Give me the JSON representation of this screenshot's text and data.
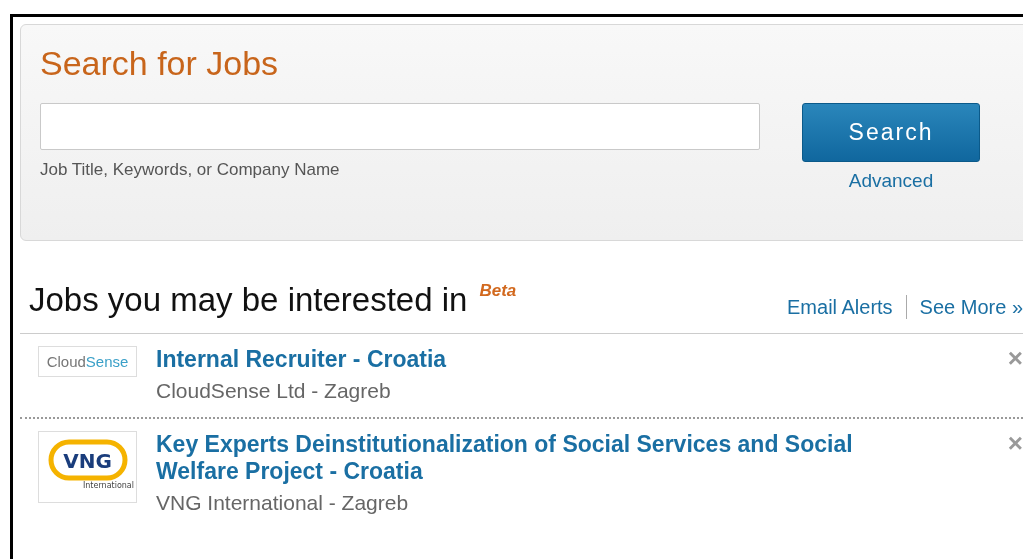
{
  "search_panel": {
    "title": "Search for Jobs",
    "field": {
      "hint": "Job Title, Keywords, or Company Name"
    },
    "button": "Search",
    "advanced_link": "Advanced"
  },
  "recommendations": {
    "heading": "Jobs you may be interested in",
    "badge": "Beta",
    "links": [
      "Email Alerts",
      "See More »"
    ],
    "jobs": [
      {
        "logo": {
          "kind": "cloudsense",
          "text": [
            "Cloud",
            "Sense"
          ]
        },
        "title": "Internal Recruiter - Croatia",
        "company": "CloudSense Ltd - Zagreb",
        "dismiss": "×"
      },
      {
        "logo": {
          "kind": "vng",
          "text": [
            "VNG",
            "International"
          ]
        },
        "title": "Key Experts Deinstitutionalization of Social Services and Social Welfare Project - Croatia",
        "company": "VNG International - Zagreb",
        "dismiss": "×"
      }
    ]
  }
}
